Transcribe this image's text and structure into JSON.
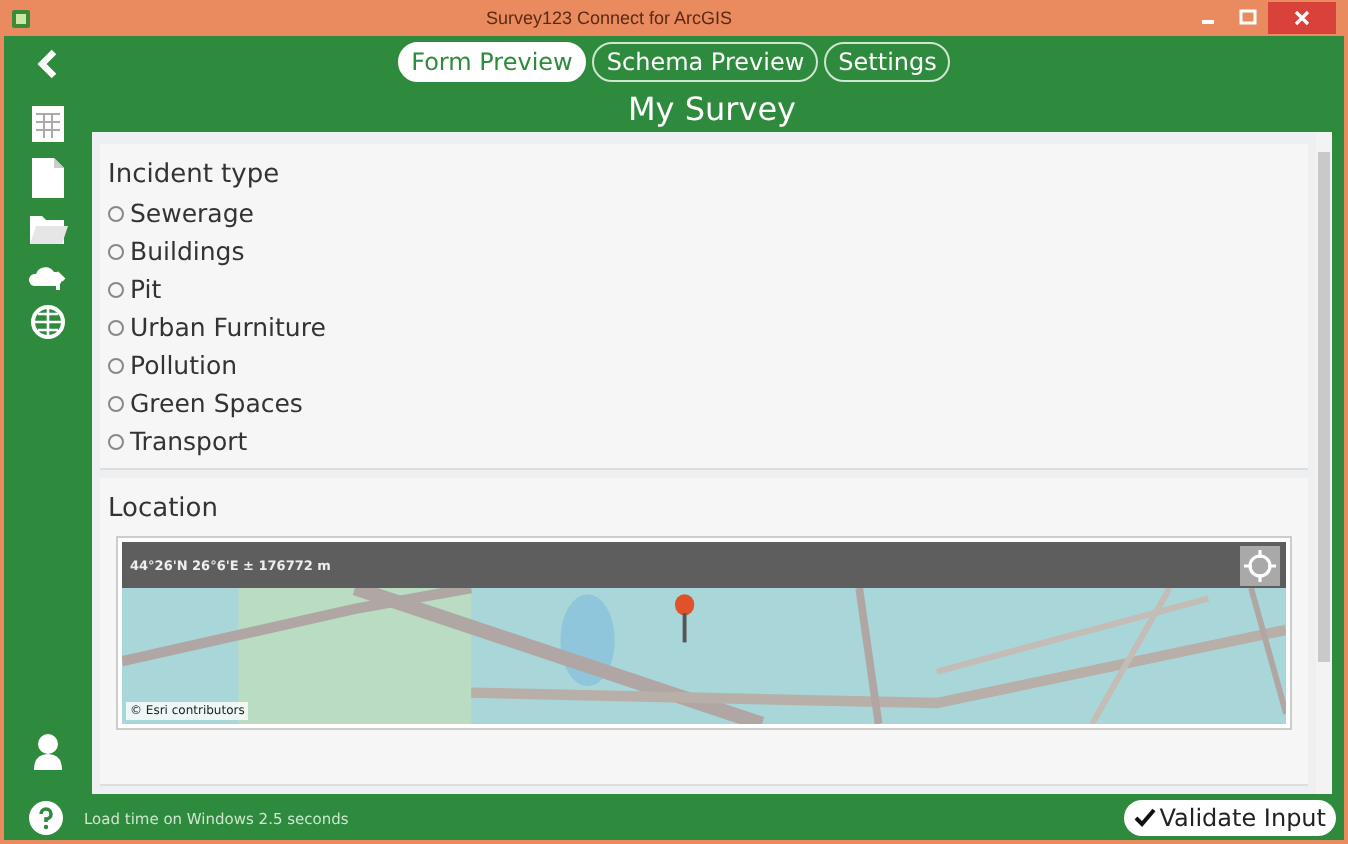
{
  "window": {
    "title": "Survey123 Connect for ArcGIS"
  },
  "tabs": [
    {
      "label": "Form Preview",
      "selected": true
    },
    {
      "label": "Schema Preview",
      "selected": false
    },
    {
      "label": "Settings",
      "selected": false
    }
  ],
  "form": {
    "title": "My Survey",
    "question": {
      "label": "Incident type",
      "options": [
        {
          "label": "Sewerage",
          "selected": false
        },
        {
          "label": "Buildings",
          "selected": false
        },
        {
          "label": "Pit",
          "selected": false
        },
        {
          "label": "Urban Furniture",
          "selected": false
        },
        {
          "label": "Pollution",
          "selected": false
        },
        {
          "label": "Green Spaces",
          "selected": false
        },
        {
          "label": "Transport",
          "selected": false
        }
      ]
    },
    "location": {
      "label": "Location",
      "coordinates": "44°26'N 26°6'E ± 176772 m",
      "attribution": "© Esri contributors"
    }
  },
  "status_bar": {
    "text": "Load time on Windows 2.5 seconds",
    "button": "Validate Input"
  }
}
